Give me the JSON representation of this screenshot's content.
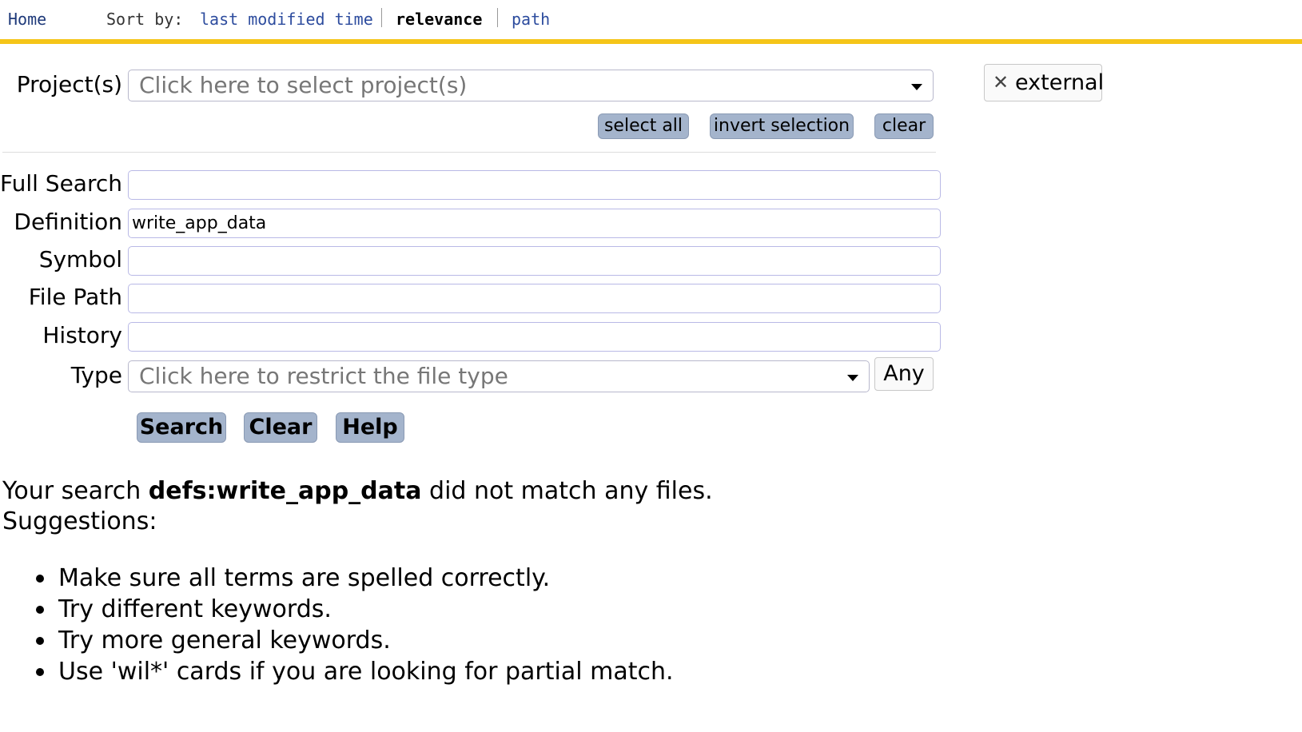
{
  "nav": {
    "home": "Home",
    "sort_by_label": "Sort by:",
    "sort_options": [
      "last modified time",
      "relevance",
      "path"
    ],
    "active_sort": "relevance"
  },
  "form": {
    "project_label": "Project(s)",
    "project_placeholder": "Click here to select project(s)",
    "select_all": "select all",
    "invert_selection": "invert selection",
    "clear_small": "clear",
    "selected_project": "external",
    "fields": [
      {
        "label": "Full Search",
        "value": ""
      },
      {
        "label": "Definition",
        "value": "write_app_data"
      },
      {
        "label": "Symbol",
        "value": ""
      },
      {
        "label": "File Path",
        "value": ""
      },
      {
        "label": "History",
        "value": ""
      }
    ],
    "type_label": "Type",
    "type_placeholder": "Click here to restrict the file type",
    "type_any": "Any",
    "search_button": "Search",
    "clear_button": "Clear",
    "help_button": "Help"
  },
  "results": {
    "prefix": "Your search ",
    "query": "defs:write_app_data",
    "suffix": " did not match any files.",
    "suggestions_label": "Suggestions:",
    "suggestions": [
      "Make sure all terms are spelled correctly.",
      "Try different keywords.",
      "Try more general keywords.",
      "Use 'wil*' cards if you are looking for partial match."
    ]
  }
}
